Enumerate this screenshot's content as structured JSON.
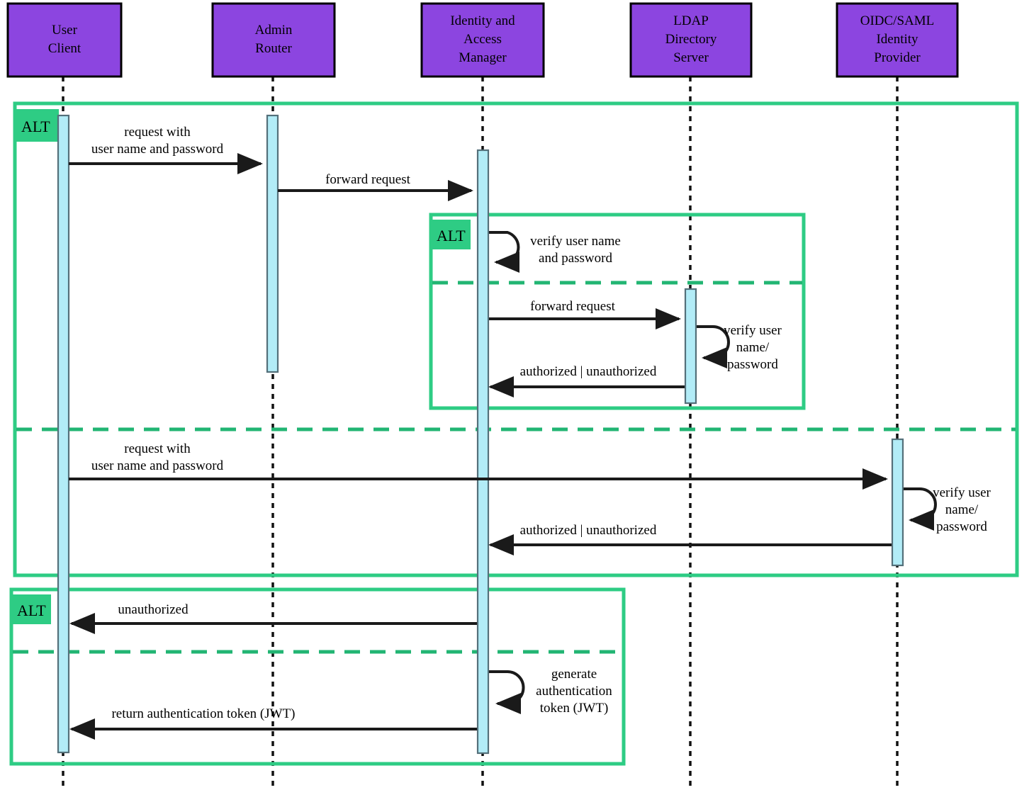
{
  "diagram": {
    "title": "Authentication sequence diagram",
    "colors": {
      "participant_fill": "#8c45e0",
      "activation_fill": "#b2ecf7",
      "frame_stroke": "#2ecc84",
      "alt_tab_fill": "#2ecc84",
      "message_stroke": "#1a1a1a",
      "lifeline_stroke": "#111111",
      "background": "#ffffff"
    }
  },
  "participants": [
    {
      "id": "user-client",
      "lines": [
        "User",
        "Client"
      ]
    },
    {
      "id": "admin-router",
      "lines": [
        "Admin",
        "Router"
      ]
    },
    {
      "id": "identity-access-manager",
      "lines": [
        "Identity and",
        "Access",
        "Manager"
      ]
    },
    {
      "id": "ldap-directory-server",
      "lines": [
        "LDAP",
        "Directory",
        "Server"
      ]
    },
    {
      "id": "oidc-saml-identity-provider",
      "lines": [
        "OIDC/SAML",
        "Identity",
        "Provider"
      ]
    }
  ],
  "fragments": [
    {
      "id": "outer-alt",
      "label": "ALT"
    },
    {
      "id": "inner-alt",
      "label": "ALT"
    },
    {
      "id": "bottom-alt",
      "label": "ALT"
    }
  ],
  "messages": [
    {
      "id": "m1",
      "lines": [
        "request with",
        "user name and password"
      ],
      "from": "user-client",
      "to": "admin-router",
      "kind": "call"
    },
    {
      "id": "m2",
      "lines": [
        "forward request"
      ],
      "from": "admin-router",
      "to": "identity-access-manager",
      "kind": "call"
    },
    {
      "id": "m3",
      "lines": [
        "verify user name",
        "and password"
      ],
      "from": "identity-access-manager",
      "to": "identity-access-manager",
      "kind": "self"
    },
    {
      "id": "m4",
      "lines": [
        "forward request"
      ],
      "from": "identity-access-manager",
      "to": "ldap-directory-server",
      "kind": "call"
    },
    {
      "id": "m5",
      "lines": [
        "verify user",
        "name/",
        "password"
      ],
      "from": "ldap-directory-server",
      "to": "ldap-directory-server",
      "kind": "self"
    },
    {
      "id": "m6",
      "lines": [
        "authorized | unauthorized"
      ],
      "from": "ldap-directory-server",
      "to": "identity-access-manager",
      "kind": "return"
    },
    {
      "id": "m7",
      "lines": [
        "request with",
        "user name and password"
      ],
      "from": "user-client",
      "to": "oidc-saml-identity-provider",
      "kind": "call"
    },
    {
      "id": "m8",
      "lines": [
        "verify user",
        "name/",
        "password"
      ],
      "from": "oidc-saml-identity-provider",
      "to": "oidc-saml-identity-provider",
      "kind": "self"
    },
    {
      "id": "m9",
      "lines": [
        "authorized | unauthorized"
      ],
      "from": "oidc-saml-identity-provider",
      "to": "identity-access-manager",
      "kind": "return"
    },
    {
      "id": "m10",
      "lines": [
        "unauthorized"
      ],
      "from": "identity-access-manager",
      "to": "user-client",
      "kind": "return"
    },
    {
      "id": "m11",
      "lines": [
        "generate",
        "authentication",
        "token (JWT)"
      ],
      "from": "identity-access-manager",
      "to": "identity-access-manager",
      "kind": "self"
    },
    {
      "id": "m12",
      "lines": [
        "return authentication token (JWT)"
      ],
      "from": "identity-access-manager",
      "to": "user-client",
      "kind": "return"
    }
  ]
}
